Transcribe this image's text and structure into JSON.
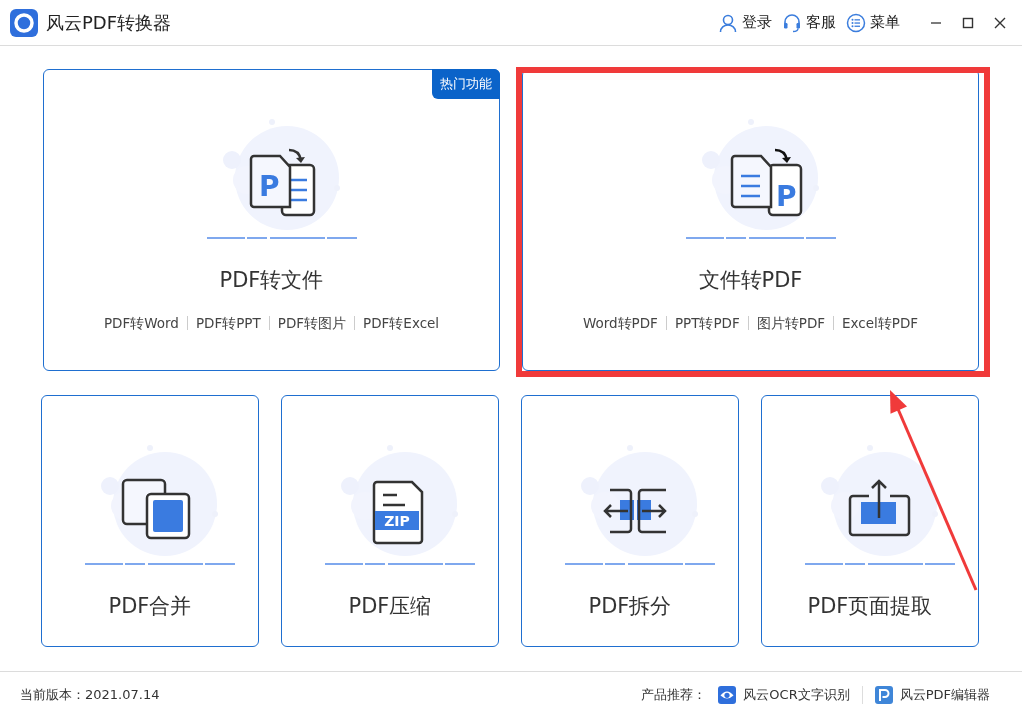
{
  "window": {
    "title": "风云PDF转换器",
    "actions": [
      "登录",
      "客服",
      "菜单"
    ]
  },
  "feature_cards": [
    {
      "kind": "pdf-to-doc",
      "icon_label": "P",
      "title": "PDF转文件",
      "badge": "热门功能",
      "highlighted": false,
      "links": [
        "PDF转Word",
        "PDF转PPT",
        "PDF转图片",
        "PDF转Excel"
      ]
    },
    {
      "kind": "doc-to-pdf",
      "icon_label": "P",
      "title": "文件转PDF",
      "highlighted": true,
      "links": [
        "Word转PDF",
        "PPT转PDF",
        "图片转PDF",
        "Excel转PDF"
      ]
    }
  ],
  "tool_cards": [
    {
      "kind": "merge",
      "title": "PDF合并"
    },
    {
      "kind": "zip",
      "icon_label": "ZIP",
      "title": "PDF压缩"
    },
    {
      "kind": "split",
      "title": "PDF拆分"
    },
    {
      "kind": "extract",
      "title": "PDF页面提取"
    }
  ],
  "status_bar": {
    "version": "当前版本：2021.07.14",
    "recommend_label": "产品推荐：",
    "products": [
      {
        "kind": "eye",
        "name": "风云OCR文字识别"
      },
      {
        "kind": "p",
        "name": "风云PDF编辑器"
      }
    ]
  }
}
